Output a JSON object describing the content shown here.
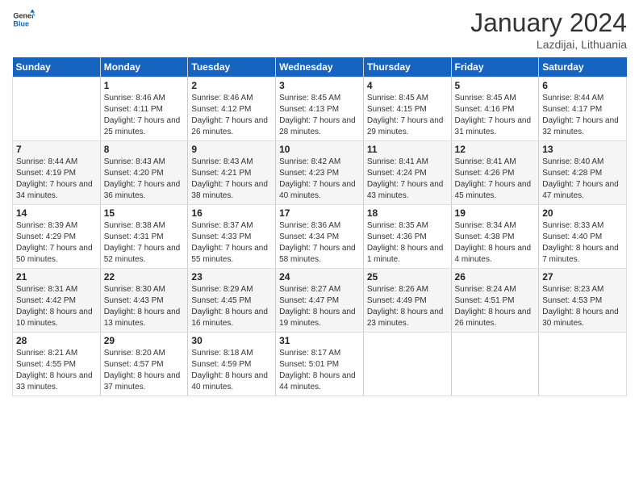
{
  "logo": {
    "general": "General",
    "blue": "Blue"
  },
  "title": "January 2024",
  "location": "Lazdijai, Lithuania",
  "weekdays": [
    "Sunday",
    "Monday",
    "Tuesday",
    "Wednesday",
    "Thursday",
    "Friday",
    "Saturday"
  ],
  "weeks": [
    [
      {
        "day": "",
        "sunrise": "",
        "sunset": "",
        "daylight": ""
      },
      {
        "day": "1",
        "sunrise": "Sunrise: 8:46 AM",
        "sunset": "Sunset: 4:11 PM",
        "daylight": "Daylight: 7 hours and 25 minutes."
      },
      {
        "day": "2",
        "sunrise": "Sunrise: 8:46 AM",
        "sunset": "Sunset: 4:12 PM",
        "daylight": "Daylight: 7 hours and 26 minutes."
      },
      {
        "day": "3",
        "sunrise": "Sunrise: 8:45 AM",
        "sunset": "Sunset: 4:13 PM",
        "daylight": "Daylight: 7 hours and 28 minutes."
      },
      {
        "day": "4",
        "sunrise": "Sunrise: 8:45 AM",
        "sunset": "Sunset: 4:15 PM",
        "daylight": "Daylight: 7 hours and 29 minutes."
      },
      {
        "day": "5",
        "sunrise": "Sunrise: 8:45 AM",
        "sunset": "Sunset: 4:16 PM",
        "daylight": "Daylight: 7 hours and 31 minutes."
      },
      {
        "day": "6",
        "sunrise": "Sunrise: 8:44 AM",
        "sunset": "Sunset: 4:17 PM",
        "daylight": "Daylight: 7 hours and 32 minutes."
      }
    ],
    [
      {
        "day": "7",
        "sunrise": "Sunrise: 8:44 AM",
        "sunset": "Sunset: 4:19 PM",
        "daylight": "Daylight: 7 hours and 34 minutes."
      },
      {
        "day": "8",
        "sunrise": "Sunrise: 8:43 AM",
        "sunset": "Sunset: 4:20 PM",
        "daylight": "Daylight: 7 hours and 36 minutes."
      },
      {
        "day": "9",
        "sunrise": "Sunrise: 8:43 AM",
        "sunset": "Sunset: 4:21 PM",
        "daylight": "Daylight: 7 hours and 38 minutes."
      },
      {
        "day": "10",
        "sunrise": "Sunrise: 8:42 AM",
        "sunset": "Sunset: 4:23 PM",
        "daylight": "Daylight: 7 hours and 40 minutes."
      },
      {
        "day": "11",
        "sunrise": "Sunrise: 8:41 AM",
        "sunset": "Sunset: 4:24 PM",
        "daylight": "Daylight: 7 hours and 43 minutes."
      },
      {
        "day": "12",
        "sunrise": "Sunrise: 8:41 AM",
        "sunset": "Sunset: 4:26 PM",
        "daylight": "Daylight: 7 hours and 45 minutes."
      },
      {
        "day": "13",
        "sunrise": "Sunrise: 8:40 AM",
        "sunset": "Sunset: 4:28 PM",
        "daylight": "Daylight: 7 hours and 47 minutes."
      }
    ],
    [
      {
        "day": "14",
        "sunrise": "Sunrise: 8:39 AM",
        "sunset": "Sunset: 4:29 PM",
        "daylight": "Daylight: 7 hours and 50 minutes."
      },
      {
        "day": "15",
        "sunrise": "Sunrise: 8:38 AM",
        "sunset": "Sunset: 4:31 PM",
        "daylight": "Daylight: 7 hours and 52 minutes."
      },
      {
        "day": "16",
        "sunrise": "Sunrise: 8:37 AM",
        "sunset": "Sunset: 4:33 PM",
        "daylight": "Daylight: 7 hours and 55 minutes."
      },
      {
        "day": "17",
        "sunrise": "Sunrise: 8:36 AM",
        "sunset": "Sunset: 4:34 PM",
        "daylight": "Daylight: 7 hours and 58 minutes."
      },
      {
        "day": "18",
        "sunrise": "Sunrise: 8:35 AM",
        "sunset": "Sunset: 4:36 PM",
        "daylight": "Daylight: 8 hours and 1 minute."
      },
      {
        "day": "19",
        "sunrise": "Sunrise: 8:34 AM",
        "sunset": "Sunset: 4:38 PM",
        "daylight": "Daylight: 8 hours and 4 minutes."
      },
      {
        "day": "20",
        "sunrise": "Sunrise: 8:33 AM",
        "sunset": "Sunset: 4:40 PM",
        "daylight": "Daylight: 8 hours and 7 minutes."
      }
    ],
    [
      {
        "day": "21",
        "sunrise": "Sunrise: 8:31 AM",
        "sunset": "Sunset: 4:42 PM",
        "daylight": "Daylight: 8 hours and 10 minutes."
      },
      {
        "day": "22",
        "sunrise": "Sunrise: 8:30 AM",
        "sunset": "Sunset: 4:43 PM",
        "daylight": "Daylight: 8 hours and 13 minutes."
      },
      {
        "day": "23",
        "sunrise": "Sunrise: 8:29 AM",
        "sunset": "Sunset: 4:45 PM",
        "daylight": "Daylight: 8 hours and 16 minutes."
      },
      {
        "day": "24",
        "sunrise": "Sunrise: 8:27 AM",
        "sunset": "Sunset: 4:47 PM",
        "daylight": "Daylight: 8 hours and 19 minutes."
      },
      {
        "day": "25",
        "sunrise": "Sunrise: 8:26 AM",
        "sunset": "Sunset: 4:49 PM",
        "daylight": "Daylight: 8 hours and 23 minutes."
      },
      {
        "day": "26",
        "sunrise": "Sunrise: 8:24 AM",
        "sunset": "Sunset: 4:51 PM",
        "daylight": "Daylight: 8 hours and 26 minutes."
      },
      {
        "day": "27",
        "sunrise": "Sunrise: 8:23 AM",
        "sunset": "Sunset: 4:53 PM",
        "daylight": "Daylight: 8 hours and 30 minutes."
      }
    ],
    [
      {
        "day": "28",
        "sunrise": "Sunrise: 8:21 AM",
        "sunset": "Sunset: 4:55 PM",
        "daylight": "Daylight: 8 hours and 33 minutes."
      },
      {
        "day": "29",
        "sunrise": "Sunrise: 8:20 AM",
        "sunset": "Sunset: 4:57 PM",
        "daylight": "Daylight: 8 hours and 37 minutes."
      },
      {
        "day": "30",
        "sunrise": "Sunrise: 8:18 AM",
        "sunset": "Sunset: 4:59 PM",
        "daylight": "Daylight: 8 hours and 40 minutes."
      },
      {
        "day": "31",
        "sunrise": "Sunrise: 8:17 AM",
        "sunset": "Sunset: 5:01 PM",
        "daylight": "Daylight: 8 hours and 44 minutes."
      },
      {
        "day": "",
        "sunrise": "",
        "sunset": "",
        "daylight": ""
      },
      {
        "day": "",
        "sunrise": "",
        "sunset": "",
        "daylight": ""
      },
      {
        "day": "",
        "sunrise": "",
        "sunset": "",
        "daylight": ""
      }
    ]
  ]
}
